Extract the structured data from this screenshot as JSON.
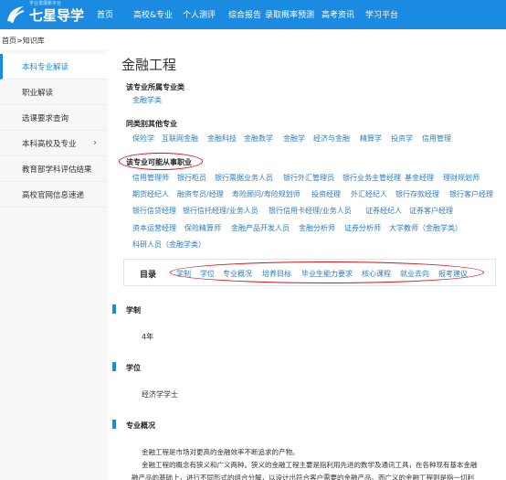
{
  "logo": {
    "text": "七星导学",
    "sub": "学业发展新平台",
    "mark": "qixing-logo"
  },
  "nav": [
    "首页",
    "高校&专业",
    "个人测评",
    "综合报告",
    "录取概率预测",
    "高考资讯",
    "学习平台"
  ],
  "breadcrumb": "首页>知识库",
  "sidebar": [
    "本科专业解读",
    "职业解读",
    "选课要求查询",
    "本科高校及专业",
    "教育部学科评估结果",
    "高校官网信息速递"
  ],
  "main": {
    "title": "金融工程",
    "category_label": "该专业所属专业类",
    "category_value": "金融学类",
    "same_label": "同类别其他专业",
    "same_majors": [
      "保险学",
      "互联网金融",
      "金融科技",
      "金融数学",
      "金融学",
      "经济与金融",
      "精算学",
      "投资学",
      "信用管理"
    ],
    "careers_label": "该专业可能从事职业",
    "careers_rows": [
      [
        "信用管理师",
        "银行柜员",
        "银行票据业务人员",
        "银行外汇管理员",
        "银行业务主管经理",
        "基金经理",
        "理财规划师"
      ],
      [
        "期货经纪人",
        "融资专员/经理",
        "寿险顾问/寿险规划师",
        "投资经理",
        "外汇经纪人",
        "银行存款经理",
        "银行客户经理"
      ],
      [
        "银行信贷经理",
        "银行信托经理/业务人员",
        "银行信用卡经理/业务人员",
        "证券经纪人",
        "证券客户经理"
      ],
      [
        "资本运营经理",
        "保险精算师",
        "金融产品开发人员",
        "金融分析师",
        "证券分析师",
        "大学教师（金融学类）"
      ],
      [
        "科研人员（金融学类）"
      ]
    ]
  },
  "directory": {
    "title": "目录",
    "links": [
      "学制",
      "学位",
      "专业概况",
      "培养目标",
      "毕业生能力要求",
      "核心课程",
      "就业去向",
      "报考建议"
    ]
  },
  "sections": [
    {
      "head": "学制",
      "text": "4年"
    },
    {
      "head": "学位",
      "text": "经济学学士"
    },
    {
      "head": "专业概况",
      "lines": [
        "金融工程是市场对更高的金融效率不断追求的产物。",
        "金融工程的概念有狭义和广义两种。狭义的金融工程主要是指利用先进的数学及通讯工具，在各种现有基本金融",
        "融产品的基础上，进行不同形式的组合分解，以设计出符合客户需要的金融产品。而广义的金融工程则是指一切利"
      ]
    }
  ],
  "colors": {
    "brand": "#1a8be0",
    "link": "#2d7bc4",
    "annotation": "#d6121a"
  }
}
